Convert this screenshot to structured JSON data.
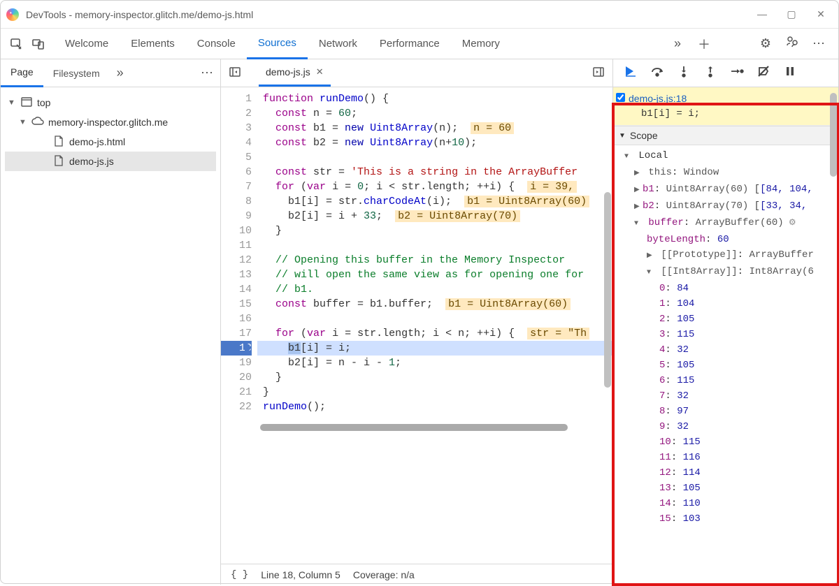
{
  "window": {
    "title": "DevTools - memory-inspector.glitch.me/demo-js.html"
  },
  "main_tabs": [
    "Welcome",
    "Elements",
    "Console",
    "Sources",
    "Network",
    "Performance",
    "Memory"
  ],
  "main_active_tab": "Sources",
  "left_nav": {
    "tabs": [
      "Page",
      "Filesystem"
    ],
    "active": "Page",
    "tree": {
      "top": "top",
      "domain": "memory-inspector.glitch.me",
      "files": [
        "demo-js.html",
        "demo-js.js"
      ],
      "selected": "demo-js.js"
    }
  },
  "editor": {
    "tab": "demo-js.js",
    "execution_line": 18,
    "lines": [
      {
        "n": 1,
        "html": "<span class='tok-kw2'>function</span> <span class='tok-fn'>runDemo</span>() {"
      },
      {
        "n": 2,
        "html": "  <span class='tok-kw2'>const</span> n = <span class='tok-num'>60</span>;"
      },
      {
        "n": 3,
        "html": "  <span class='tok-kw2'>const</span> b1 = <span class='tok-kw'>new</span> <span class='tok-fn'>Uint8Array</span>(n);  <span class='inline-eval'>n = 60</span>"
      },
      {
        "n": 4,
        "html": "  <span class='tok-kw2'>const</span> b2 = <span class='tok-kw'>new</span> <span class='tok-fn'>Uint8Array</span>(n+<span class='tok-num'>10</span>);"
      },
      {
        "n": 5,
        "html": ""
      },
      {
        "n": 6,
        "html": "  <span class='tok-kw2'>const</span> str = <span class='tok-str'>'This is a string in the ArrayBuffer</span>"
      },
      {
        "n": 7,
        "html": "  <span class='tok-kw2'>for</span> (<span class='tok-kw2'>var</span> i = <span class='tok-num'>0</span>; i &lt; str.length; ++i) {  <span class='inline-eval'>i = 39,</span> "
      },
      {
        "n": 8,
        "html": "    b1[i] = str.<span class='tok-fn'>charCodeAt</span>(i);  <span class='inline-eval'>b1 = Uint8Array(60)</span>"
      },
      {
        "n": 9,
        "html": "    b2[i] = i + <span class='tok-num'>33</span>;  <span class='inline-eval'>b2 = Uint8Array(70)</span>"
      },
      {
        "n": 10,
        "html": "  }"
      },
      {
        "n": 11,
        "html": ""
      },
      {
        "n": 12,
        "html": "  <span class='tok-com'>// Opening this buffer in the Memory Inspector</span>"
      },
      {
        "n": 13,
        "html": "  <span class='tok-com'>// will open the same view as for opening one for</span>"
      },
      {
        "n": 14,
        "html": "  <span class='tok-com'>// b1.</span>"
      },
      {
        "n": 15,
        "html": "  <span class='tok-kw2'>const</span> buffer = b1.buffer;  <span class='inline-eval'>b1 = Uint8Array(60)</span>"
      },
      {
        "n": 16,
        "html": ""
      },
      {
        "n": 17,
        "html": "  <span class='tok-kw2'>for</span> (<span class='tok-kw2'>var</span> i = str.length; i &lt; n; ++i) {  <span class='inline-eval'>str = \"Th</span>"
      },
      {
        "n": 18,
        "html": "    <span style='background:#a8c4ef'>b1</span>[i] = i;",
        "exec": true
      },
      {
        "n": 19,
        "html": "    b2[i] = n - i - <span class='tok-num'>1</span>;"
      },
      {
        "n": 20,
        "html": "  }"
      },
      {
        "n": 21,
        "html": "}"
      },
      {
        "n": 22,
        "html": "<span class='tok-fn'>runDemo</span>();"
      }
    ]
  },
  "status": {
    "position": "Line 18, Column 5",
    "coverage": "Coverage: n/a"
  },
  "debugger": {
    "breakpoint": {
      "location": "demo-js.js:18",
      "code": "b1[i] = i;"
    },
    "scope_label": "Scope",
    "local_label": "Local",
    "this_label": "this",
    "this_val": "Window",
    "b1": {
      "name": "b1",
      "type": "Uint8Array(60)",
      "preview": "[84, 104,"
    },
    "b2": {
      "name": "b2",
      "type": "Uint8Array(70)",
      "preview": "[33, 34,"
    },
    "buffer": {
      "name": "buffer",
      "type": "ArrayBuffer(60)",
      "byteLength_label": "byteLength",
      "byteLength": "60",
      "proto_label": "[[Prototype]]",
      "proto_val": "ArrayBuffer",
      "int8_label": "[[Int8Array]]",
      "int8_val": "Int8Array(6"
    },
    "int8_values": [
      {
        "i": "0",
        "v": "84"
      },
      {
        "i": "1",
        "v": "104"
      },
      {
        "i": "2",
        "v": "105"
      },
      {
        "i": "3",
        "v": "115"
      },
      {
        "i": "4",
        "v": "32"
      },
      {
        "i": "5",
        "v": "105"
      },
      {
        "i": "6",
        "v": "115"
      },
      {
        "i": "7",
        "v": "32"
      },
      {
        "i": "8",
        "v": "97"
      },
      {
        "i": "9",
        "v": "32"
      },
      {
        "i": "10",
        "v": "115"
      },
      {
        "i": "11",
        "v": "116"
      },
      {
        "i": "12",
        "v": "114"
      },
      {
        "i": "13",
        "v": "105"
      },
      {
        "i": "14",
        "v": "110"
      },
      {
        "i": "15",
        "v": "103"
      }
    ]
  }
}
